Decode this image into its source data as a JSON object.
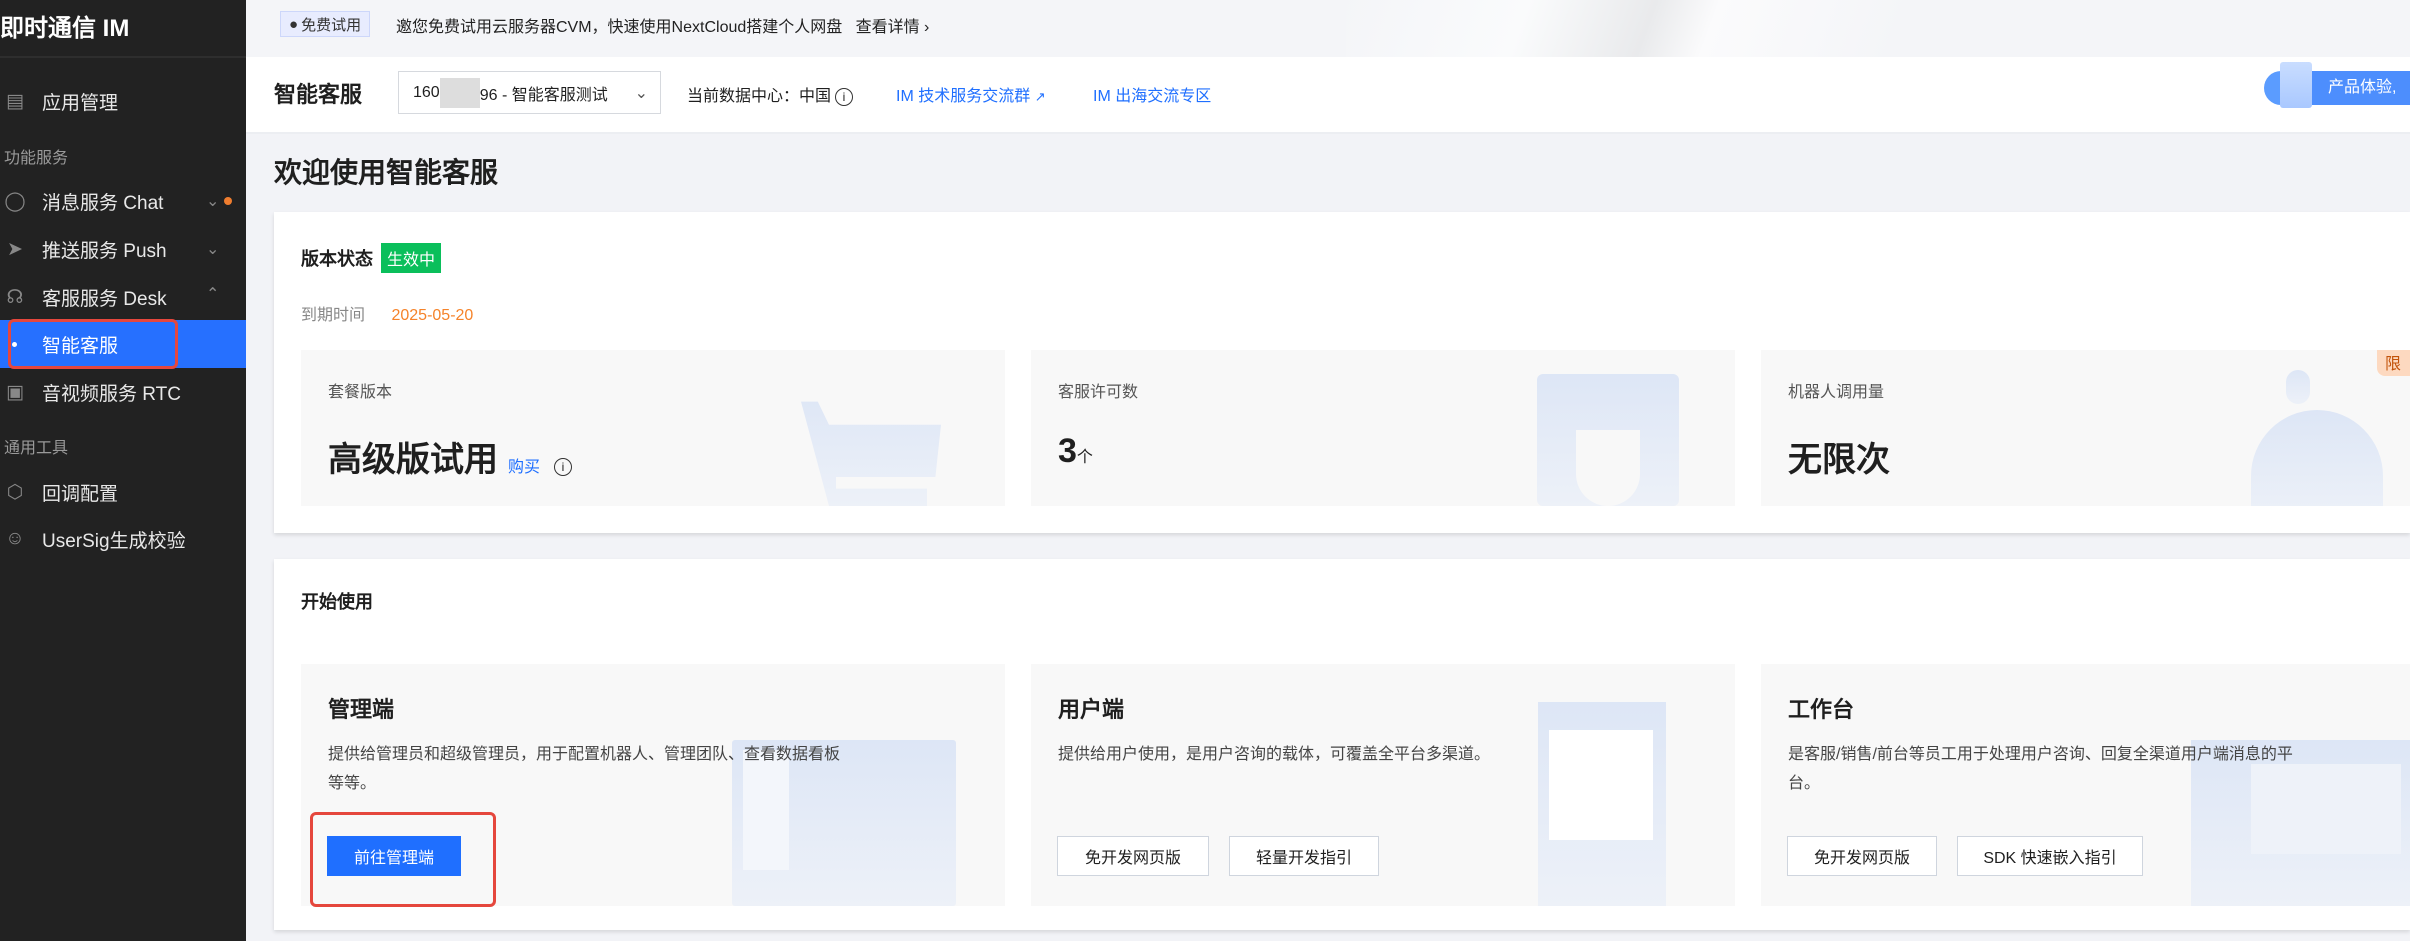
{
  "sidebar": {
    "app_title": "即时通信 IM",
    "items": [
      {
        "label": "应用管理"
      },
      {
        "label": "消息服务 Chat"
      },
      {
        "label": "推送服务 Push"
      },
      {
        "label": "客服服务 Desk"
      },
      {
        "label": "智能客服"
      },
      {
        "label": "音视频服务 RTC"
      },
      {
        "label": "回调配置"
      },
      {
        "label": "UserSig生成校验"
      }
    ],
    "groups": [
      "功能服务",
      "通用工具"
    ]
  },
  "banner": {
    "tag": "免费试用",
    "message": "邀您免费试用云服务器CVM，快速使用NextCloud搭建个人网盘",
    "link": "查看详情 ›"
  },
  "header": {
    "title": "智能客服",
    "app_select": {
      "prefix": "160",
      "suffix": "96 - 智能客服测试"
    },
    "data_center": "当前数据中心：中国",
    "link_group": "IM 技术服务交流群",
    "link_overseas": "IM 出海交流专区",
    "promo": "产品体验,"
  },
  "page_title": "欢迎使用智能客服",
  "status_card": {
    "title": "版本状态",
    "status_badge": "生效中",
    "expiry_label": "到期时间",
    "expiry_date": "2025-05-20",
    "stats": [
      {
        "label": "套餐版本",
        "value": "高级版试用",
        "action": "购买"
      },
      {
        "label": "客服许可数",
        "value": "3",
        "unit": "个"
      },
      {
        "label": "机器人调用量",
        "value": "无限次",
        "badge": "限"
      }
    ]
  },
  "start_card": {
    "title": "开始使用",
    "items": [
      {
        "title": "管理端",
        "desc_line1": "提供给管理员和超级管理员，用于配置机器人、管理团队、查看数据看板",
        "desc_line2": "等等。",
        "buttons": [
          "前往管理端"
        ]
      },
      {
        "title": "用户端",
        "desc_line1": "提供给用户使用，是用户咨询的载体，可覆盖全平台多渠道。",
        "buttons": [
          "免开发网页版",
          "轻量开发指引"
        ]
      },
      {
        "title": "工作台",
        "desc_line1": "是客服/销售/前台等员工用于处理用户咨询、回复全渠道用户端消息的平",
        "desc_line2": "台。",
        "buttons": [
          "免开发网页版",
          "SDK 快速嵌入指引"
        ]
      }
    ]
  },
  "colors": {
    "accent": "#1f6fff",
    "active_nav": "#2670ff",
    "success": "#0abf5b",
    "warning": "#f5832a",
    "highlight": "#e5473d"
  }
}
